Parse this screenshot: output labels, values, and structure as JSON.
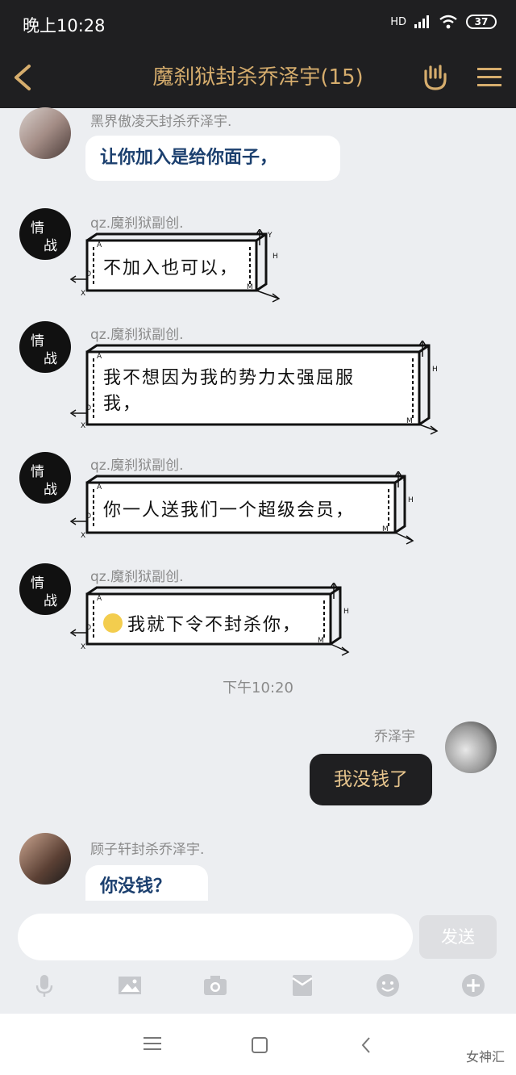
{
  "status_bar": {
    "time": "晚上10:28",
    "network": "HD",
    "battery": "37"
  },
  "header": {
    "title": "魔刹狱封杀乔泽宇(15)"
  },
  "messages": [
    {
      "sender": "黑界傲凌天封杀乔泽宇.",
      "text": "让你加入是给你面子，"
    },
    {
      "sender": "qz.魔刹狱副创.",
      "text": "不加入也可以，",
      "avatar_text": [
        "情",
        "战"
      ]
    },
    {
      "sender": "qz.魔刹狱副创.",
      "text_line1": "我不想因为我的势力太强屈服",
      "text_line2": "我，",
      "avatar_text": [
        "情",
        "战"
      ]
    },
    {
      "sender": "qz.魔刹狱副创.",
      "text": "你一人送我们一个超级会员，",
      "avatar_text": [
        "情",
        "战"
      ]
    },
    {
      "sender": "qz.魔刹狱副创.",
      "text": "我就下令不封杀你，",
      "avatar_text": [
        "情",
        "战"
      ]
    }
  ],
  "box_labels": {
    "a": "A",
    "y": "Y",
    "h": "H",
    "o": "O",
    "x": "X",
    "m": "M"
  },
  "time_separator": "下午10:20",
  "self_message": {
    "sender": "乔泽宇",
    "text": "我没钱了"
  },
  "last_message": {
    "sender": "顾子轩封杀乔泽宇.",
    "text": "你没钱？"
  },
  "input_bar": {
    "placeholder": "",
    "send_label": "发送"
  },
  "toolbar_icons": [
    "mic-icon",
    "image-icon",
    "camera-icon",
    "red-packet-icon",
    "emoji-icon",
    "plus-icon"
  ],
  "watermark": "女神汇",
  "colors": {
    "header_bg": "#1f1f21",
    "title_gold": "#d6ad6d",
    "chat_bg": "#eceef1"
  }
}
